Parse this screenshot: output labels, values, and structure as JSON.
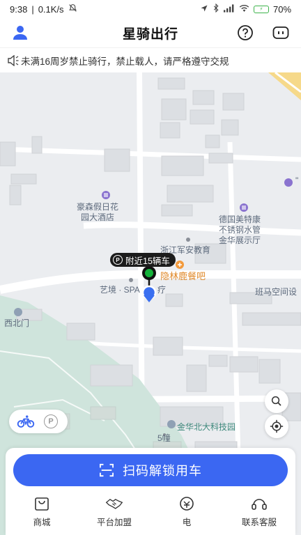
{
  "status_bar": {
    "time": "9:38",
    "speed": "0.1K/s",
    "battery": "70"
  },
  "header": {
    "title": "星骑出行"
  },
  "notice": {
    "text": "未满16周岁禁止骑行，禁止载人，请严格遵守交规"
  },
  "map": {
    "labels": {
      "hotel": "豪森假日花\n园大酒店",
      "delight": "德国美特康\n不锈钢水管\n金华展示厅",
      "edu": "浙江军安教育",
      "restaurant": "隐林鹿餐吧",
      "spa": "艺境 · SPA",
      "spa_tail": "疗",
      "banma": "班马空间设",
      "west_gate": "西北门",
      "park": "金华北大科技园",
      "building": "5幢"
    },
    "callout": {
      "p_symbol": "P",
      "text": "附近15辆车"
    },
    "mode_toggle": {
      "parking_symbol": "P"
    }
  },
  "bottom": {
    "scan_label": "扫码解锁用车",
    "nav": [
      {
        "label": "商城",
        "icon": "shop-bag-icon"
      },
      {
        "label": "平台加盟",
        "icon": "handshake-icon"
      },
      {
        "label": "电",
        "icon": "wallet-icon"
      },
      {
        "label": "联系客服",
        "icon": "headset-icon"
      }
    ]
  },
  "colors": {
    "primary": "#3b67f2",
    "callout_bg": "#1c1c1c",
    "marker_green": "#14b23a",
    "map_bg": "#ebedf0",
    "park_green": "#cfe4dc"
  }
}
